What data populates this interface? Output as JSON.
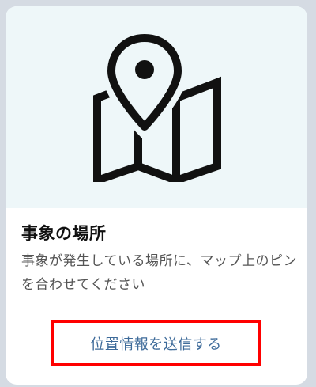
{
  "card": {
    "icon": "map-pin-icon",
    "title": "事象の場所",
    "description": "事象が発生している場所に、マップ上のピンを合わせてください",
    "button_label": "位置情報を送信する"
  },
  "colors": {
    "hero_background": "#eef7f9",
    "button_text": "#3e6b9a",
    "highlight_border": "#ff0000"
  }
}
